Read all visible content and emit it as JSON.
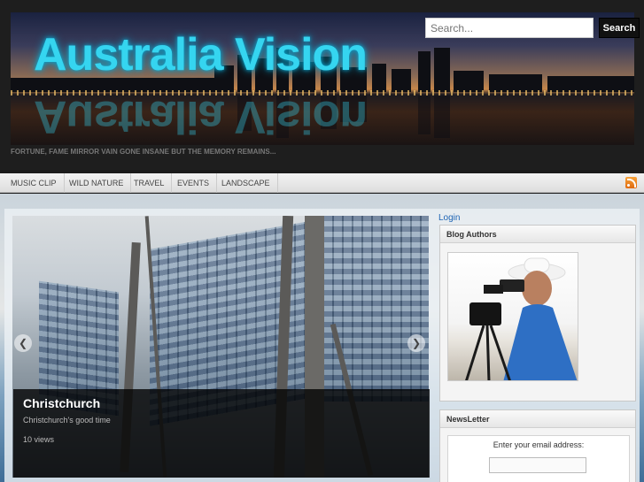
{
  "header": {
    "site_title": "Australia Vision",
    "tagline": "FORTUNE, FAME MIRROR VAIN GONE INSANE BUT THE MEMORY REMAINS...",
    "search": {
      "placeholder": "Search...",
      "button_label": "Search"
    }
  },
  "nav": {
    "items": [
      {
        "label": "MUSIC CLIP"
      },
      {
        "label": "WILD NATURE"
      },
      {
        "label": "TRAVEL"
      },
      {
        "label": "EVENTS"
      },
      {
        "label": "LANDSCAPE"
      }
    ],
    "rss_icon": "rss-icon"
  },
  "slider": {
    "title": "Christchurch",
    "description": "Christchurch's good time",
    "views": "10 views",
    "prev_icon": "chevron-left-icon",
    "next_icon": "chevron-right-icon"
  },
  "sidebar": {
    "login_label": "Login",
    "authors_title": "Blog Authors",
    "newsletter_title": "NewsLetter",
    "newsletter_label": "Enter your email address:"
  },
  "colors": {
    "title_glow": "#35d5f0",
    "link": "#1e64b4",
    "search_button": "#111111",
    "rss": "#f08a24"
  }
}
